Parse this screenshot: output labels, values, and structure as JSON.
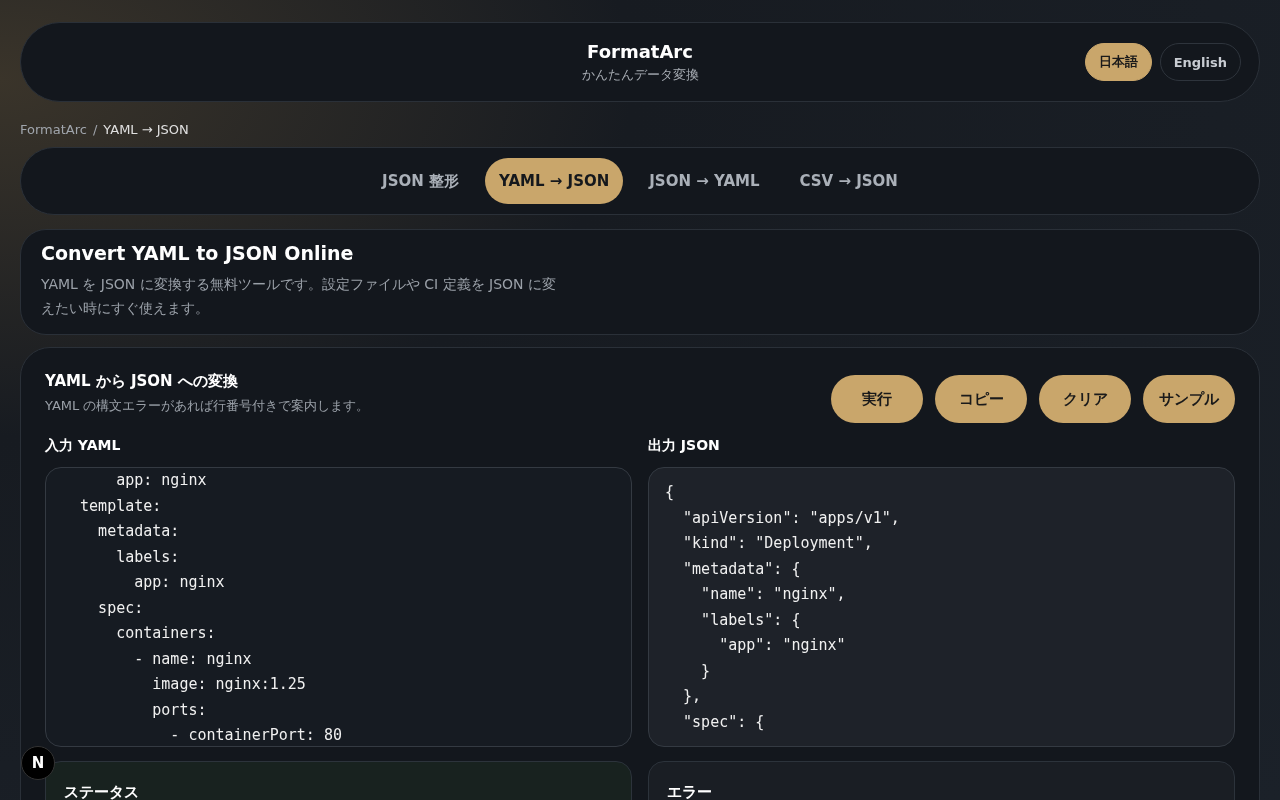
{
  "header": {
    "title": "FormatArc",
    "subtitle": "かんたんデータ変換",
    "languages": [
      {
        "label": "日本語",
        "selected": true
      },
      {
        "label": "English",
        "selected": false
      }
    ]
  },
  "breadcrumb": {
    "separator": "/",
    "items": [
      "FormatArc",
      "YAML → JSON"
    ]
  },
  "tabs": [
    {
      "label": "JSON 整形",
      "selected": false
    },
    {
      "label": "YAML → JSON",
      "selected": true
    },
    {
      "label": "JSON → YAML",
      "selected": false
    },
    {
      "label": "CSV → JSON",
      "selected": false
    }
  ],
  "intro": {
    "title": "Convert YAML to JSON Online",
    "description": "YAML を JSON に変換する無料ツールです。設定ファイルや CI 定義を JSON に変えたい時にすぐ使えます。"
  },
  "converter": {
    "title": "YAML から JSON への変換",
    "subtitle": "YAML の構文エラーがあれば行番号付きで案内します。",
    "buttons": [
      "実行",
      "コピー",
      "クリア",
      "サンプル"
    ],
    "input": {
      "label": "入力 YAML",
      "lines": [
        "      app: nginx",
        "  template:",
        "    metadata:",
        "      labels:",
        "        app: nginx",
        "    spec:",
        "      containers:",
        "        - name: nginx",
        "          image: nginx:1.25",
        "          ports:",
        "            - containerPort: 80"
      ]
    },
    "output": {
      "label": "出力 JSON",
      "lines": [
        "{",
        "  \"apiVersion\": \"apps/v1\",",
        "  \"kind\": \"Deployment\",",
        "  \"metadata\": {",
        "    \"name\": \"nginx\",",
        "    \"labels\": {",
        "      \"app\": \"nginx\"",
        "    }",
        "  },",
        "  \"spec\": {"
      ]
    },
    "status": {
      "title": "ステータス"
    },
    "error": {
      "title": "エラー"
    }
  },
  "dev_badge": "N"
}
